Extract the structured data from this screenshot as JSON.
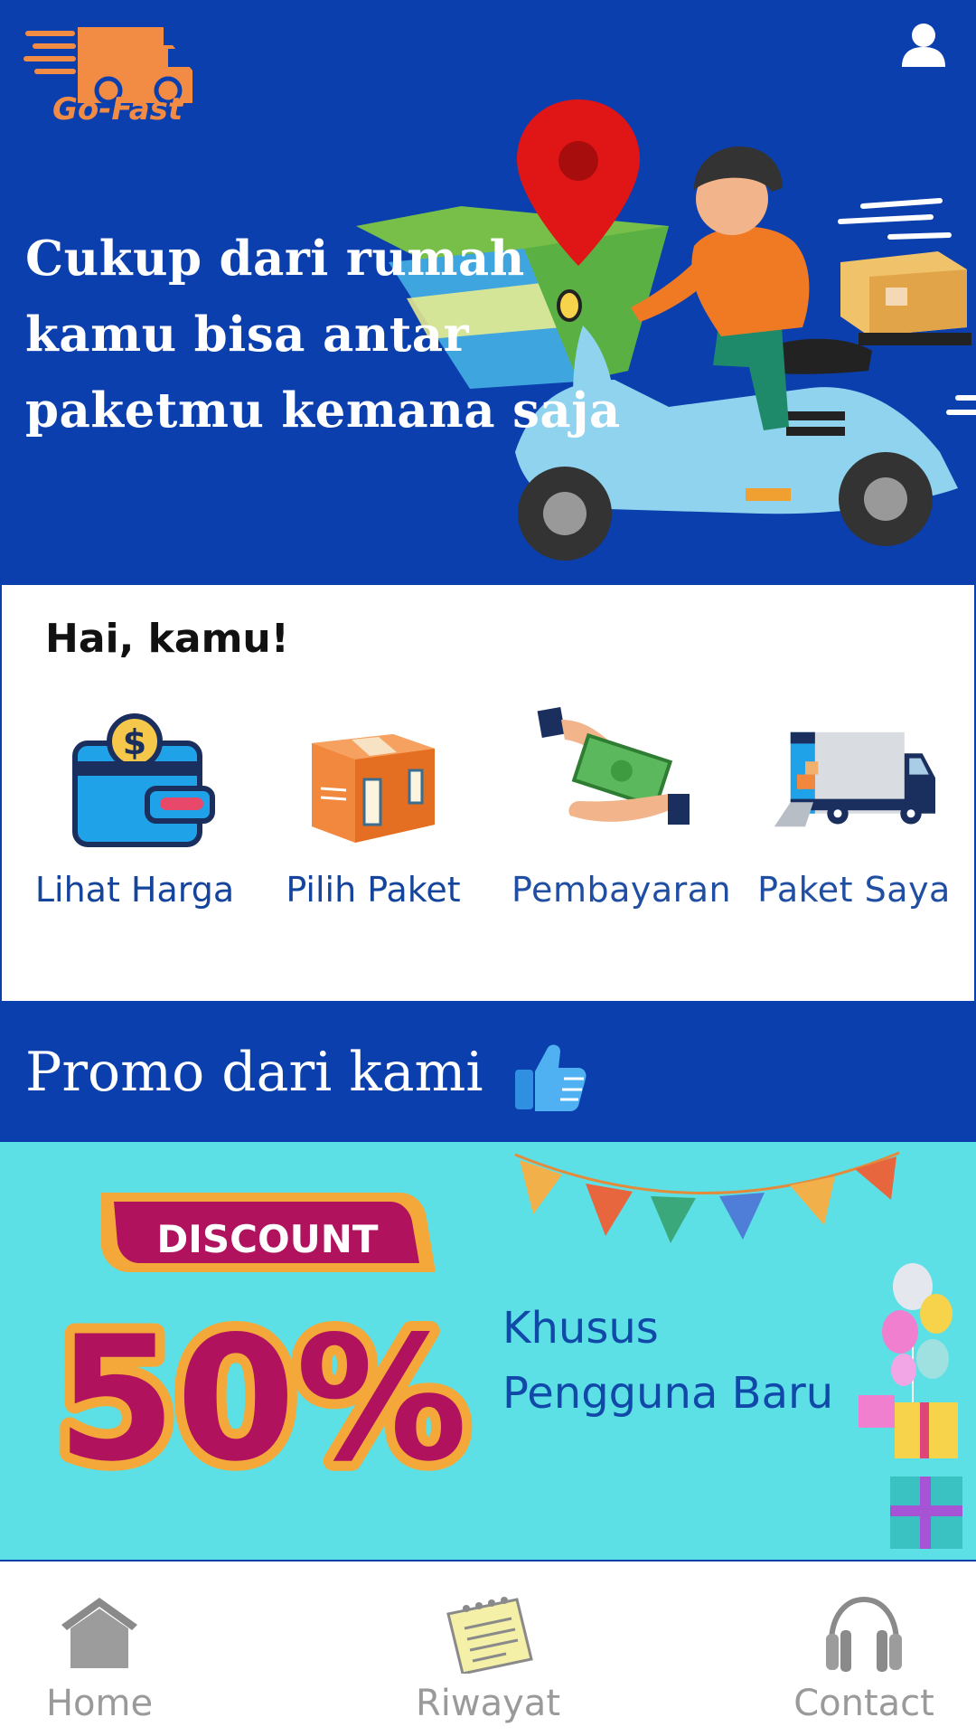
{
  "app": {
    "logo_text": "Go-Fast"
  },
  "hero": {
    "title_line1": "Cukup dari rumah",
    "title_line2": "kamu bisa antar",
    "title_line3": "paketmu kemana saja"
  },
  "menu": {
    "greeting": "Hai, kamu!",
    "items": [
      {
        "label": "Lihat Harga",
        "icon": "wallet-icon"
      },
      {
        "label": "Pilih Paket",
        "icon": "package-box-icon"
      },
      {
        "label": "Pembayaran",
        "icon": "payment-money-icon"
      },
      {
        "label": "Paket Saya",
        "icon": "delivery-truck-icon"
      }
    ]
  },
  "promo": {
    "section_title": "Promo dari kami",
    "badge_text": "DISCOUNT",
    "percent_text": "50%",
    "line1": "Khusus",
    "line2": "Pengguna Baru"
  },
  "bottom_nav": {
    "items": [
      {
        "label": "Home",
        "icon": "home-icon"
      },
      {
        "label": "Riwayat",
        "icon": "notepad-icon"
      },
      {
        "label": "Contact",
        "icon": "headphones-icon"
      }
    ]
  },
  "colors": {
    "brand_blue": "#0b3fae",
    "brand_orange": "#f28c45",
    "promo_bg": "#5ce0e6",
    "menu_text": "#14449c",
    "nav_gray": "#9a9a9a"
  }
}
